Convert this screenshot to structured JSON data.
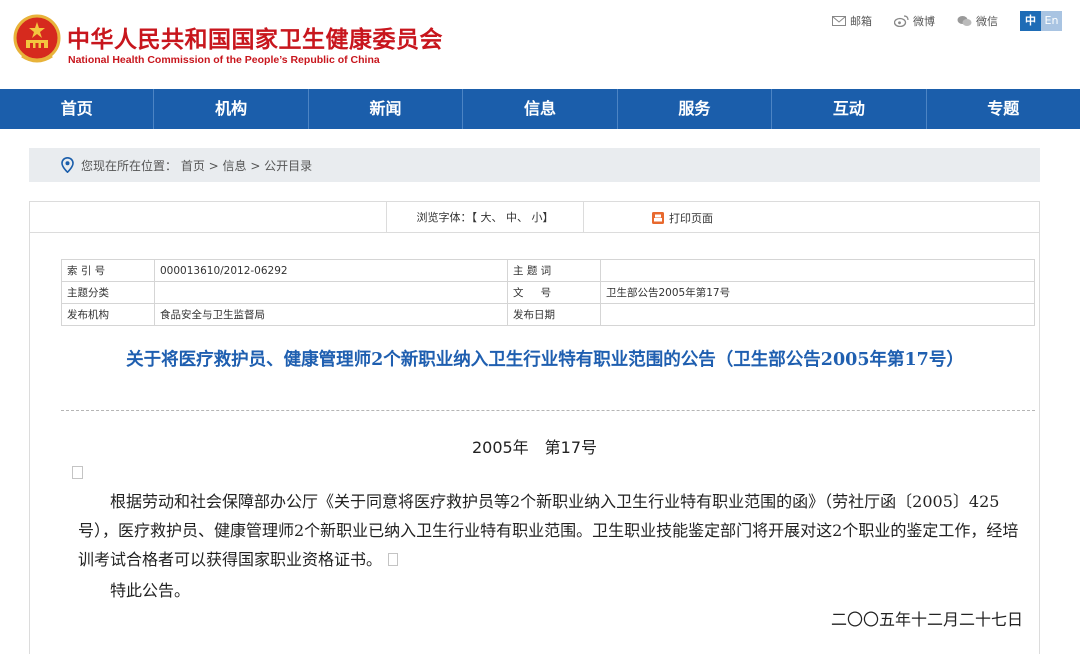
{
  "header": {
    "title_cn": "中华人民共和国国家卫生健康委员会",
    "title_en": "National Health Commission of the People’s Republic of China",
    "links": [
      {
        "icon": "mail-icon",
        "label": "邮箱"
      },
      {
        "icon": "weibo-icon",
        "label": "微博"
      },
      {
        "icon": "wechat-icon",
        "label": "微信"
      }
    ],
    "lang_cn": "中",
    "lang_en": "En"
  },
  "nav": [
    "首页",
    "机构",
    "新闻",
    "信息",
    "服务",
    "互动",
    "专题"
  ],
  "breadcrumb": "您现在所在位置： 首页 > 信息 > 公开目录",
  "toolbar": {
    "font_size_label": "浏览字体：【 大、 中、 小】",
    "print_label": "打印页面"
  },
  "meta": {
    "index_label": "索 引 号",
    "index_value": "000013610/2012-06292",
    "topic_label": "主 题 词",
    "topic_value": "",
    "category_label": "主题分类",
    "category_value": "",
    "docno_label": "文 　 号",
    "docno_value": "卫生部公告2005年第17号",
    "issuer_label": "发布机构",
    "issuer_value": "食品安全与卫生监督局",
    "date_label": "发布日期",
    "date_value": ""
  },
  "document": {
    "title": "关于将医疗救护员、健康管理师2个新职业纳入卫生行业特有职业范围的公告（卫生部公告2005年第17号）",
    "number": "2005年　第17号",
    "body": "根据劳动和社会保障部办公厅《关于同意将医疗救护员等2个新职业纳入卫生行业特有职业范围的函》（劳社厅函〔2005〕425号），医疗救护员、健康管理师2个新职业已纳入卫生行业特有职业范围。卫生职业技能鉴定部门将开展对这2个职业的鉴定工作，经培训考试合格者可以获得国家职业资格证书。",
    "closing": "特此公告。",
    "date": "二〇〇五年十二月二十七日"
  },
  "colors": {
    "brand_red": "#c8161d",
    "nav_blue": "#1b5eab",
    "title_blue": "#1f5fb0"
  }
}
